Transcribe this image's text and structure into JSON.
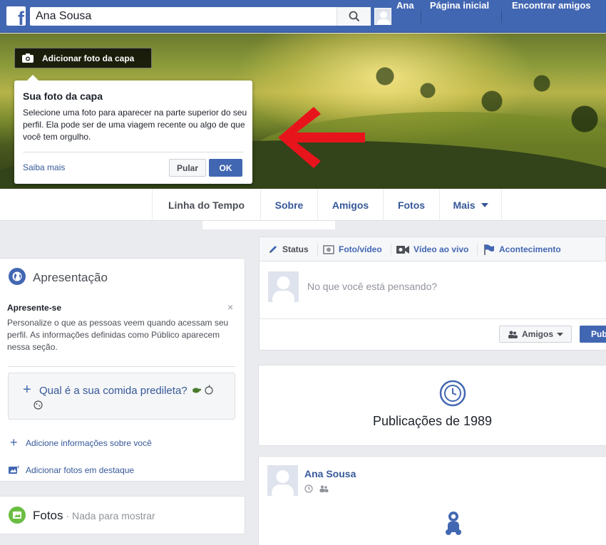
{
  "topbar": {
    "logo": "f",
    "search_value": "Ana Sousa",
    "user_name": "Ana",
    "home_label": "Página inicial",
    "find_friends_label": "Encontrar amigos",
    "accent": "#4267b2"
  },
  "cover": {
    "add_cover_label": "Adicionar foto da capa"
  },
  "tooltip": {
    "title": "Sua foto da capa",
    "body": "Selecione uma foto para aparecer na parte superior do seu perfil. Ela pode ser de uma viagem recente ou algo de que você tem orgulho.",
    "learn_more": "Saiba mais",
    "skip_label": "Pular",
    "ok_label": "OK",
    "arrow_color": "#e8141c"
  },
  "profile_nav": {
    "tabs": [
      "Linha do Tempo",
      "Sobre",
      "Amigos",
      "Fotos",
      "Mais"
    ]
  },
  "intro": {
    "title": "Apresentação",
    "heading": "Apresente-se",
    "close": "×",
    "text": "Personalize o que as pessoas veem quando acessam seu perfil. As informações definidas como Público aparecem nessa seção.",
    "food_prompt": "Qual é a sua comida predileta?",
    "add_info": "Adicione informações sobre você",
    "add_photos": "Adicionar fotos em destaque"
  },
  "photos_card": {
    "title": "Fotos",
    "subtitle": " · Nada para mostrar"
  },
  "composer": {
    "tabs": [
      "Status",
      "Foto/vídeo",
      "Vídeo ao vivo",
      "Acontecimento"
    ],
    "placeholder": "No que você está pensando?",
    "audience": "Amigos",
    "publish": "Pub"
  },
  "year_card": {
    "title": "Publicações de 1989"
  },
  "post": {
    "name": "Ana Sousa"
  }
}
